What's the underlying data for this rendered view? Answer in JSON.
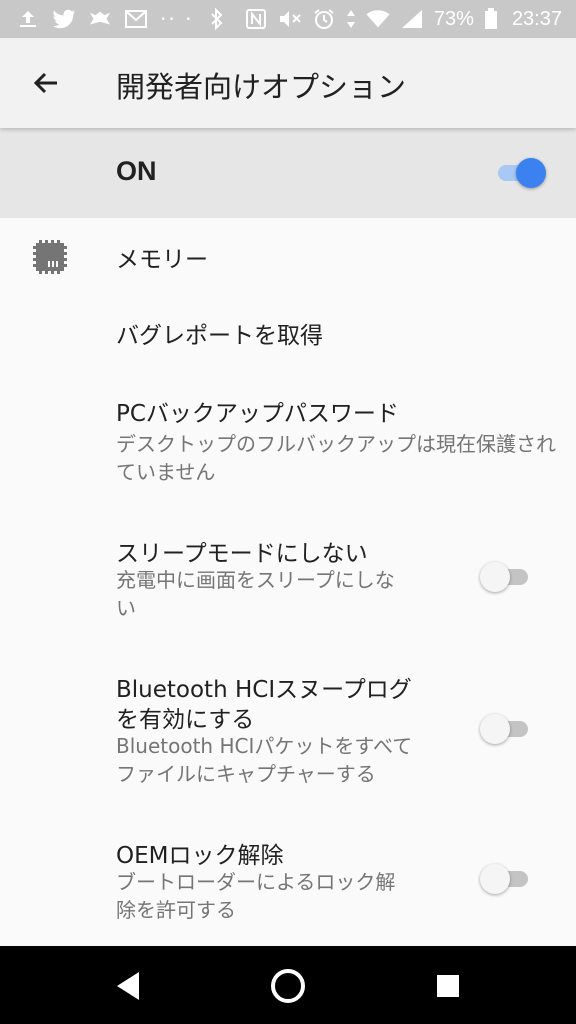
{
  "status_bar": {
    "battery_percent": "73%",
    "time": "23:37",
    "icons": [
      "upload-icon",
      "twitter-icon",
      "notification-icon",
      "gmail-icon",
      "more-dots-icon",
      "bluetooth-icon",
      "nfc-icon",
      "mute-icon",
      "alarm-icon",
      "data-arrows-icon",
      "wifi-icon",
      "signal-icon",
      "battery-icon"
    ]
  },
  "app_bar": {
    "title": "開発者向けオプション",
    "back_icon": "arrow-back-icon"
  },
  "master_switch": {
    "label": "ON",
    "state": true,
    "accent_color": "#3b82f0"
  },
  "settings": [
    {
      "title": "メモリー",
      "icon": "memory-chip-icon"
    },
    {
      "title": "バグレポートを取得"
    },
    {
      "title": "PCバックアップパスワード",
      "summary": "デスクトップのフルバックアップは現在保護されていません"
    },
    {
      "title": "スリープモードにしない",
      "summary_line1": "充電中に画面をスリープにしな",
      "summary_line2": "い",
      "switch": false
    },
    {
      "title_line1": "Bluetooth HCIスヌープログ",
      "title_line2": "を有効にする",
      "summary_line1": "Bluetooth HCIパケットをすべて",
      "summary_line2": "ファイルにキャプチャーする",
      "switch": false
    },
    {
      "title": "OEMロック解除",
      "summary_line1": "ブートローダーによるロック解",
      "summary_line2": "除を許可する",
      "switch": false
    }
  ],
  "nav_bar": {
    "icons": [
      "back-triangle-icon",
      "home-circle-icon",
      "recents-square-icon"
    ]
  }
}
